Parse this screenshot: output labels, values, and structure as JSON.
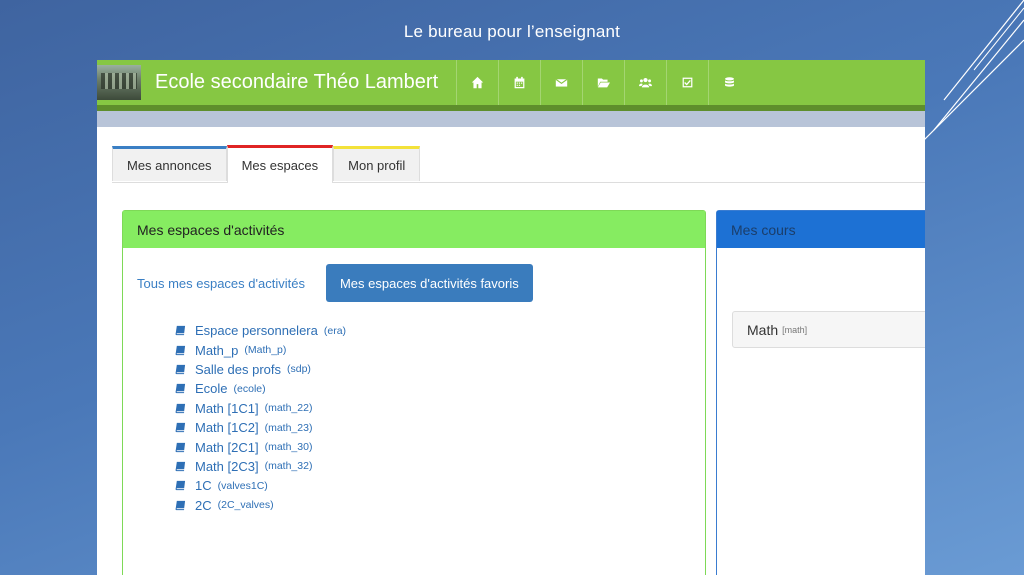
{
  "slide": {
    "title": "Le bureau pour  l’enseignant"
  },
  "topbar": {
    "school_name": "Ecole secondaire Théo Lambert",
    "nav_icons": [
      "home-icon",
      "calendar-icon",
      "envelope-icon",
      "folder-open-icon",
      "users-icon",
      "check-square-icon",
      "database-icon"
    ]
  },
  "tabs": [
    {
      "label": "Mes annonces",
      "color": "#3a7fc4"
    },
    {
      "label": "Mes espaces",
      "color": "#e02424",
      "active": true
    },
    {
      "label": "Mon profil",
      "color": "#f3e23a"
    }
  ],
  "activities": {
    "title": "Mes espaces d'activités",
    "filter_all": "Tous mes espaces d'activités",
    "filter_favorites": "Mes espaces d'activités favoris",
    "items": [
      {
        "name": "Espace personnelera",
        "code": "(era)"
      },
      {
        "name": "Math_p",
        "code": "(Math_p)"
      },
      {
        "name": "Salle des profs",
        "code": "(sdp)"
      },
      {
        "name": "Ecole",
        "code": "(ecole)"
      },
      {
        "name": "Math [1C1]",
        "code": "(math_22)"
      },
      {
        "name": "Math [1C2]",
        "code": "(math_23)"
      },
      {
        "name": "Math [2C1]",
        "code": "(math_30)"
      },
      {
        "name": "Math [2C3]",
        "code": "(math_32)"
      },
      {
        "name": "1C",
        "code": "(valves1C)"
      },
      {
        "name": "2C",
        "code": "(2C_valves)"
      }
    ]
  },
  "courses": {
    "title": "Mes cours",
    "items": [
      {
        "name": "Math",
        "code": "[math]"
      }
    ]
  },
  "colors": {
    "topbar": "#86c743",
    "activities_header": "#86ec61",
    "courses_header": "#1d71d4",
    "favorites_button": "#3a7cbd",
    "link": "#2e6fb5"
  }
}
